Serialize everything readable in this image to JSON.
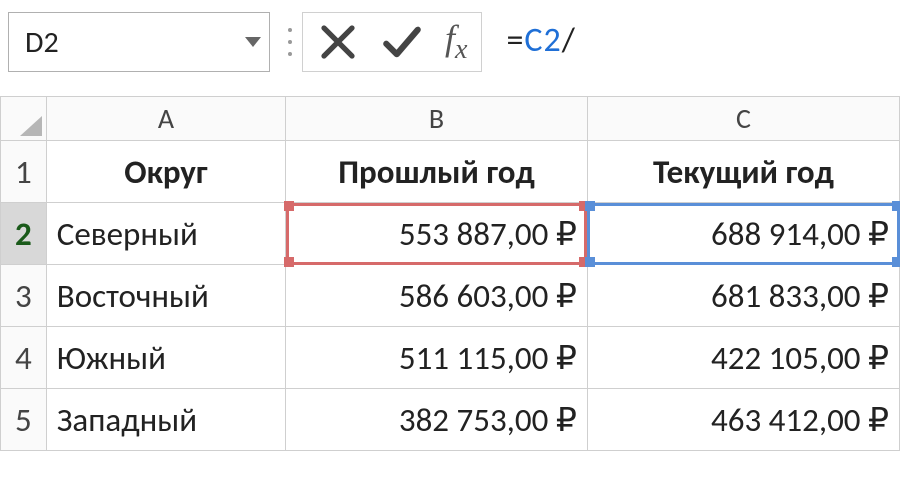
{
  "name_box": {
    "value": "D2"
  },
  "formula": {
    "prefix": "=",
    "ref": "C2",
    "suffix": "/"
  },
  "columns": [
    "A",
    "B",
    "C"
  ],
  "rows": [
    "1",
    "2",
    "3",
    "4",
    "5"
  ],
  "active_row": "2",
  "headers": {
    "A": "Округ",
    "B": "Прошлый год",
    "C": "Текущий год"
  },
  "data": [
    {
      "A": "Северный",
      "B": "553 887,00 ₽",
      "C": "688 914,00 ₽"
    },
    {
      "A": "Восточный",
      "B": "586 603,00 ₽",
      "C": "681 833,00 ₽"
    },
    {
      "A": "Южный",
      "B": "511 115,00 ₽",
      "C": "422 105,00 ₽"
    },
    {
      "A": "Западный",
      "B": "382 753,00 ₽",
      "C": "463 412,00 ₽"
    }
  ],
  "highlights": {
    "red": {
      "cell": "B2"
    },
    "blue": {
      "cell": "C2"
    }
  }
}
